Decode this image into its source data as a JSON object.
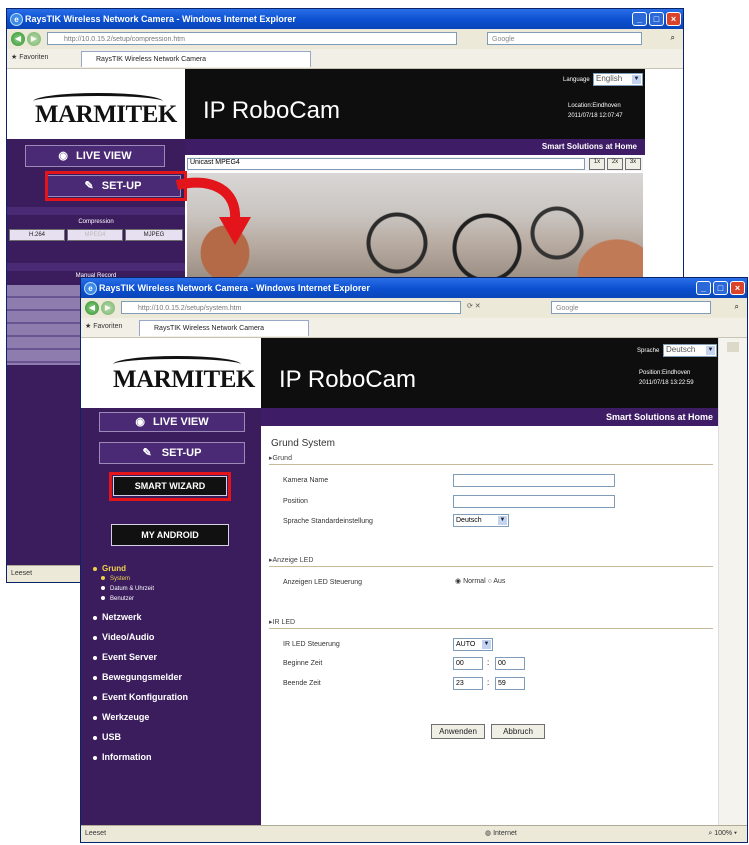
{
  "back": {
    "title": "RaysTIK Wireless Network Camera - Windows Internet Explorer",
    "address": "http://10.0.15.2/setup/compression.htm",
    "search_placeholder": "Google",
    "favorites": "Favoriten",
    "tab": "RaysTIK Wireless Network Camera",
    "logo": "MARMITEK",
    "brand": "IP RoboCam",
    "lang_label": "Language",
    "lang_value": "English",
    "location": "Location:Eindhoven",
    "datetime": "2011/07/18 12:07:47",
    "tagline": "Smart Solutions at Home",
    "live_view": "LIVE VIEW",
    "setup": "SET-UP",
    "compression": "Compression",
    "codec_1": "H.264",
    "codec_2": "MPEG4",
    "codec_3": "MJPEG",
    "manual_record": "Manual Record",
    "stream": "Unicast MPEG4",
    "status": "Leeset"
  },
  "front": {
    "title": "RaysTIK Wireless Network Camera - Windows Internet Explorer",
    "address": "http://10.0.15.2/setup/system.htm",
    "search_placeholder": "Google",
    "favorites": "Favoriten",
    "tab": "RaysTIK Wireless Network Camera",
    "logo": "MARMITEK",
    "brand": "IP RoboCam",
    "lang_label": "Sprache",
    "lang_value": "Deutsch",
    "location": "Position:Eindhoven",
    "datetime": "2011/07/18 13:22:59",
    "tagline": "Smart Solutions at Home",
    "live_view": "LIVE VIEW",
    "setup": "SET-UP",
    "smart_wizard": "SMART WIZARD",
    "my_android": "MY ANDROID",
    "menu": {
      "grund": "Grund",
      "system": "System",
      "datum": "Datum & Uhrzeit",
      "benutzer": "Benutzer",
      "items": [
        "Netzwerk",
        "Video/Audio",
        "Event Server",
        "Bewegungsmelder",
        "Event Konfiguration",
        "Werkzeuge",
        "USB",
        "Information"
      ]
    },
    "page_title": "Grund  System",
    "sections": {
      "grund": "Grund",
      "anzeige": "Anzeige LED",
      "irled": "IR LED"
    },
    "fields": {
      "kamera_name": "Kamera Name",
      "position": "Position",
      "sprache": "Sprache Standardeinstellung",
      "sprache_value": "Deutsch",
      "anzeige_steuerung": "Anzeigen LED Steuerung",
      "normal": "Normal",
      "aus": "Aus",
      "ir_steuerung": "IR LED Steuerung",
      "ir_value": "AUTO",
      "beginn": "Beginne Zeit",
      "beginn_h": "00",
      "beginn_m": "00",
      "beende": "Beende Zeit",
      "beende_h": "23",
      "beende_m": "59"
    },
    "apply": "Anwenden",
    "cancel": "Abbruch",
    "status": "Leeset",
    "zone": "Internet",
    "zoom": "100%"
  },
  "colors": {
    "purple": "#3b1d5e",
    "highlight_red": "#e4141b",
    "header_black": "#0e0e0e"
  }
}
